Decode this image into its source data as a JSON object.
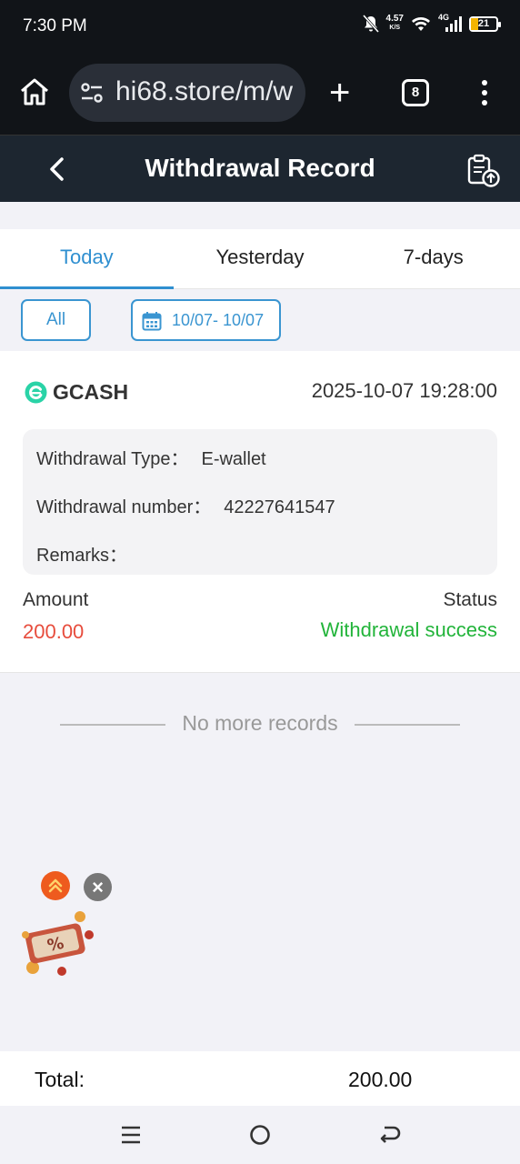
{
  "status_bar": {
    "time": "7:30 PM",
    "net_speed": "4.57",
    "net_speed_unit": "K/S",
    "network_type": "4G",
    "battery": "21",
    "icons": [
      "mute-bell-icon",
      "wifi-icon",
      "signal-icon",
      "battery-icon"
    ]
  },
  "browser": {
    "url": "hi68.store/m/w",
    "tab_count": "8"
  },
  "header": {
    "title": "Withdrawal Record"
  },
  "tabs": [
    {
      "label": "Today",
      "active": true
    },
    {
      "label": "Yesterday",
      "active": false
    },
    {
      "label": "7-days",
      "active": false
    }
  ],
  "filters": {
    "all_label": "All",
    "date_range": "10/07- 10/07"
  },
  "records": [
    {
      "channel": "GCASH",
      "datetime": "2025-10-07 19:28:00",
      "type_label": "Withdrawal Type：",
      "type_value": "E-wallet",
      "number_label": "Withdrawal number：",
      "number_value": "42227641547",
      "remarks_label": "Remarks：",
      "remarks_value": "",
      "amount_label": "Amount",
      "amount_value": "200.00",
      "status_label": "Status",
      "status_value": "Withdrawal success"
    }
  ],
  "end_text": "No more records",
  "total": {
    "label": "Total:",
    "value": "200.00"
  },
  "colors": {
    "accent": "#2f8fd0",
    "amount": "#e74c3c",
    "success": "#22b43a",
    "header_bg": "#1d2630"
  }
}
